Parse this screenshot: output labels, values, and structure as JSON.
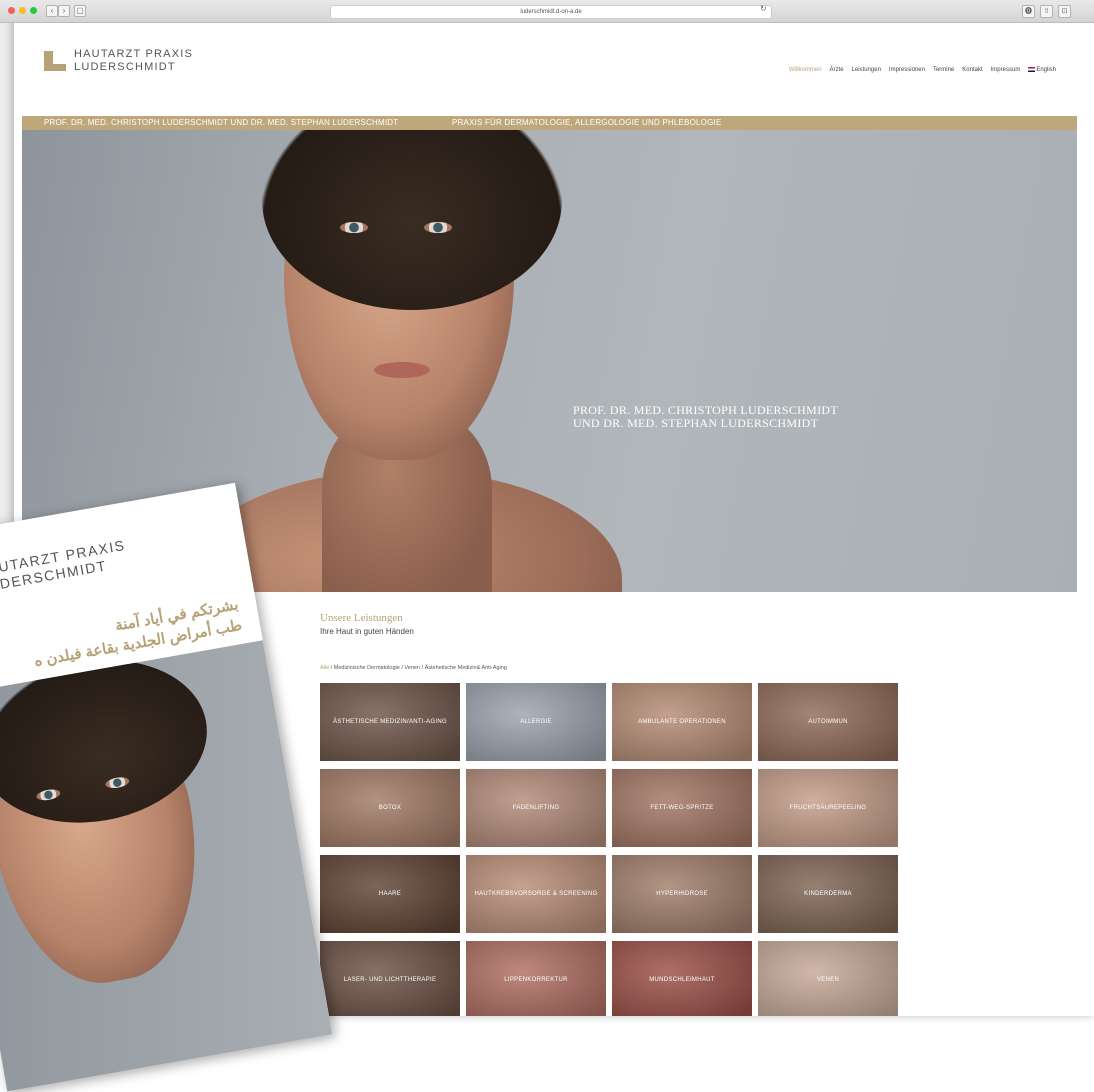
{
  "browser": {
    "url": "luderschmidt.d-on-a.de",
    "back_label": "‹",
    "forward_label": "›",
    "sidebar_label": "▢",
    "reload_label": "↻",
    "tools": [
      "⓿",
      "⇧",
      "⊡"
    ]
  },
  "header": {
    "logo_line1": "HAUTARZT PRAXIS",
    "logo_line2": "LUDERSCHMIDT",
    "nav": [
      {
        "label": "Willkommen",
        "active": true
      },
      {
        "label": "Ärzte"
      },
      {
        "label": "Leistungen"
      },
      {
        "label": "Impressionen"
      },
      {
        "label": "Termine"
      },
      {
        "label": "Kontakt"
      },
      {
        "label": "Impressum"
      }
    ],
    "lang_label": "English"
  },
  "banner": {
    "doctors": "PROF. DR. MED. CHRISTOPH LUDERSCHMIDT UND DR. MED. STEPHAN LUDERSCHMIDT",
    "practice": "PRAXIS FÜR DERMATOLOGIE, ALLERGOLOGIE UND PHLEBOLOGIE"
  },
  "hero": {
    "line1": "PROF. DR. MED. CHRISTOPH  LUDERSCHMIDT",
    "line2": "UND DR. MED. STEPHAN LUDERSCHMIDT"
  },
  "services": {
    "title": "Unsere Leistungen",
    "subtitle": "Ihre Haut in guten Händen",
    "filters": [
      {
        "label": "Alle",
        "active": true
      },
      {
        "label": "Medizinische Dermatologie"
      },
      {
        "label": "Venen"
      },
      {
        "label": "Ästehetische Medizin& Anti-Aging"
      }
    ],
    "tiles": [
      {
        "label": "ÄSTHETISCHE MEDIZIN/ANTI-AGING",
        "color": "#6e5548"
      },
      {
        "label": "ALLERGIE",
        "color": "#9aa3ad"
      },
      {
        "label": "AMBULANTE OPERATIONEN",
        "color": "#b58b74"
      },
      {
        "label": "AUTOIMMUN",
        "color": "#8f6a57"
      },
      {
        "label": "BOTOX",
        "color": "#a17a65"
      },
      {
        "label": "FADENLIFTING",
        "color": "#b18a78"
      },
      {
        "label": "FETT-WEG-SPRITZE",
        "color": "#a27563"
      },
      {
        "label": "FRUCHTSÄUREPEELING",
        "color": "#c49d88"
      },
      {
        "label": "HAARE",
        "color": "#5f4334"
      },
      {
        "label": "HAUTKREBSVORSORGE & SCREENING",
        "color": "#b98d77"
      },
      {
        "label": "HYPERHIDROSE",
        "color": "#a07e6b"
      },
      {
        "label": "KINDERDERMA",
        "color": "#7e6453"
      },
      {
        "label": "LASER- UND LICHTTHERAPIE",
        "color": "#6c5044"
      },
      {
        "label": "LIPPENKORREKTUR",
        "color": "#b06e62"
      },
      {
        "label": "MUNDSCHLEIMHAUT",
        "color": "#9b5047"
      },
      {
        "label": "VENEN",
        "color": "#c6a898"
      }
    ]
  },
  "brochure": {
    "line1": "HAUTARZT PRAXIS",
    "line2": "LUDERSCHMIDT",
    "arabic1": "بشرتكم في أياد آمنة",
    "arabic2": "طب أمراض الجلدية بقاعة فيلدن ه"
  }
}
